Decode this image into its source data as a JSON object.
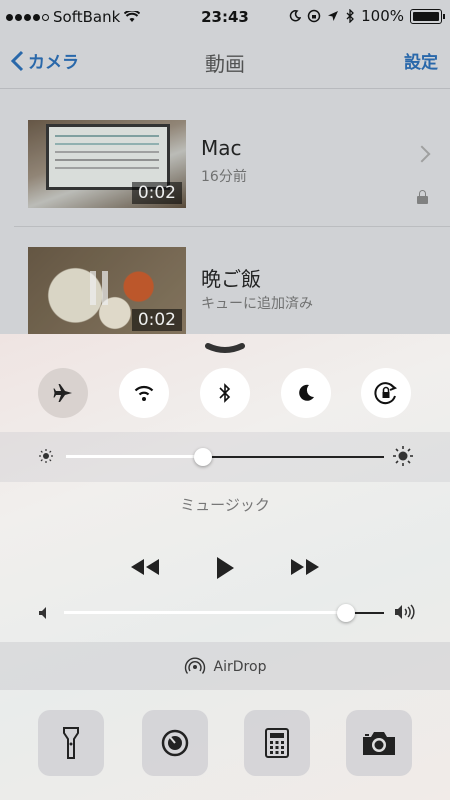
{
  "status_bar": {
    "carrier": "SoftBank",
    "time": "23:43",
    "battery": "100%"
  },
  "nav": {
    "back_label": "カメラ",
    "title": "動画",
    "right_label": "設定"
  },
  "videos": [
    {
      "title": "Mac",
      "subtitle": "16分前",
      "duration": "0:02"
    },
    {
      "title": "晩ご飯",
      "subtitle": "キューに追加済み",
      "duration": "0:02"
    }
  ],
  "control_center": {
    "toggles": [
      {
        "icon": "airplane-icon",
        "on": false
      },
      {
        "icon": "wifi-icon",
        "on": true
      },
      {
        "icon": "bluetooth-icon",
        "on": true
      },
      {
        "icon": "moon-icon",
        "on": true
      },
      {
        "icon": "rotation-lock-icon",
        "on": true
      }
    ],
    "brightness": 0.43,
    "music_label": "ミュージック",
    "volume": 0.88,
    "airdrop_label": "AirDrop",
    "tools": [
      "flashlight-icon",
      "timer-icon",
      "calculator-icon",
      "camera-icon"
    ]
  },
  "colors": {
    "accent": "#2a6db5"
  }
}
